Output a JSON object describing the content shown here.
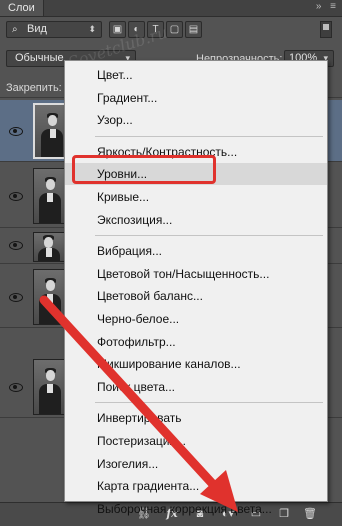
{
  "panel": {
    "tab_title": "Слои",
    "header_icons": [
      "collapse-icon",
      "panel-menu-icon"
    ]
  },
  "filter": {
    "kind_label": "Вид",
    "icons": [
      "image-filter-icon",
      "adjustment-filter-icon",
      "type-filter-icon",
      "shape-filter-icon",
      "smart-object-filter-icon"
    ]
  },
  "blend": {
    "mode": "Обычные",
    "opacity_label": "Непрозрачность:",
    "opacity_value": "100%"
  },
  "lock": {
    "label": "Закрепить:"
  },
  "layers": [
    {
      "name": "layer-1",
      "selected": true
    },
    {
      "name": "layer-2",
      "selected": false
    },
    {
      "name": "layer-3",
      "selected": false
    },
    {
      "name": "layer-4",
      "selected": false
    },
    {
      "name": "layer-5",
      "selected": false
    }
  ],
  "menu": {
    "groups": [
      [
        "Цвет...",
        "Градиент...",
        "Узор..."
      ],
      [
        "Яркость/Контрастность...",
        "Уровни...",
        "Кривые...",
        "Экспозиция..."
      ],
      [
        "Вибрация...",
        "Цветовой тон/Насыщенность...",
        "Цветовой баланс...",
        "Черно-белое...",
        "Фотофильтр...",
        "Микширование каналов...",
        "Поиск цвета..."
      ],
      [
        "Инвертировать",
        "Постеризация...",
        "Изогелия...",
        "Карта градиента...",
        "Выборочная коррекция цвета..."
      ]
    ],
    "highlighted": "Уровни..."
  },
  "bottom_bar": {
    "icons": [
      "link-layers-icon",
      "fx-icon",
      "mask-icon",
      "adjustment-layer-icon",
      "group-icon",
      "new-layer-icon",
      "trash-icon"
    ],
    "fx_label": "fx"
  },
  "watermark": "Sovetclub.ru",
  "annotation": {
    "box_color": "#e0322d",
    "arrow_color": "#e0322d"
  },
  "colors": {
    "panel_bg": "#535353",
    "selected_layer": "#5c6e86",
    "menu_bg": "#f0f0f0",
    "menu_highlight": "#d8d8d8"
  }
}
